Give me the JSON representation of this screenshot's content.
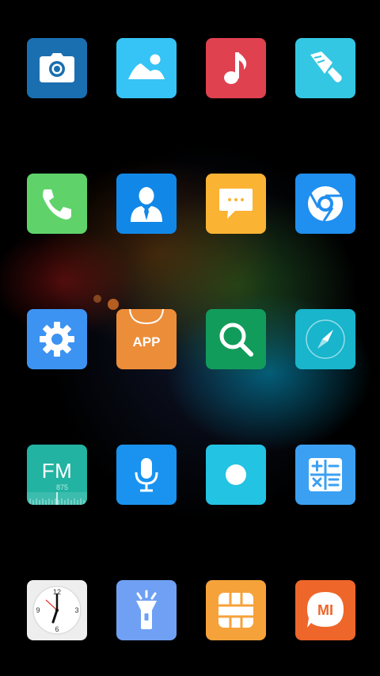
{
  "screen": "home-screen",
  "apps": [
    {
      "id": "camera",
      "icon": "camera-icon",
      "color": "#1a6fb0"
    },
    {
      "id": "gallery",
      "icon": "landscape-icon",
      "color": "#36c3f5"
    },
    {
      "id": "music",
      "icon": "music-note-icon",
      "color": "#e0414f"
    },
    {
      "id": "themes",
      "icon": "paintbrush-icon",
      "color": "#34c7e3"
    },
    {
      "id": "phone",
      "icon": "phone-icon",
      "color": "#5fd36a"
    },
    {
      "id": "contacts",
      "icon": "person-icon",
      "color": "#1188e8"
    },
    {
      "id": "messaging",
      "icon": "chat-bubble-icon",
      "color": "#fbb334"
    },
    {
      "id": "browser",
      "icon": "browser-icon",
      "color": "#1f8ff0"
    },
    {
      "id": "settings",
      "icon": "gear-icon",
      "color": "#3c93f2"
    },
    {
      "id": "app-store",
      "icon": "shopping-bag-icon",
      "color": "#ec8d3a",
      "label": "APP"
    },
    {
      "id": "search",
      "icon": "magnifier-icon",
      "color": "#129c5c"
    },
    {
      "id": "compass",
      "icon": "compass-icon",
      "color": "#18b5cc"
    },
    {
      "id": "fm-radio",
      "icon": "radio-icon",
      "color": "#22b3a2",
      "label": "FM",
      "sub": "875"
    },
    {
      "id": "recorder",
      "icon": "microphone-icon",
      "color": "#1993ef"
    },
    {
      "id": "screen-recorder",
      "icon": "record-dot-icon",
      "color": "#23c3e3"
    },
    {
      "id": "calculator",
      "icon": "calculator-icon",
      "color": "#3ca0f2"
    },
    {
      "id": "clock",
      "icon": "clock-icon",
      "color": "#eeeeee",
      "numerals": [
        "12",
        "3",
        "6",
        "9"
      ]
    },
    {
      "id": "flashlight",
      "icon": "flashlight-icon",
      "color": "#6fa0f4"
    },
    {
      "id": "sim-toolkit",
      "icon": "sim-card-icon",
      "color": "#f6a23a"
    },
    {
      "id": "mi-community",
      "icon": "mi-logo-icon",
      "color": "#ee6629",
      "label": "MI"
    }
  ]
}
